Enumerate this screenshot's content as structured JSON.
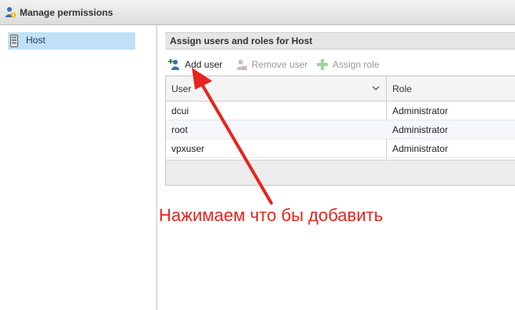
{
  "window": {
    "title": "Manage permissions",
    "title_icon": "users-icon"
  },
  "sidebar": {
    "items": [
      {
        "label": "Host",
        "icon": "host-icon",
        "selected": true
      }
    ]
  },
  "section": {
    "title": "Assign users and roles for Host"
  },
  "toolbar": {
    "add_label": "Add user",
    "remove_label": "Remove user",
    "assign_label": "Assign role"
  },
  "table": {
    "columns": [
      "User",
      "Role"
    ],
    "rows": [
      {
        "user": "dcui",
        "role": "Administrator"
      },
      {
        "user": "root",
        "role": "Administrator"
      },
      {
        "user": "vpxuser",
        "role": "Administrator"
      }
    ]
  },
  "annotation": {
    "text": "Нажимаем что бы добавить",
    "color": "#e8231e"
  }
}
